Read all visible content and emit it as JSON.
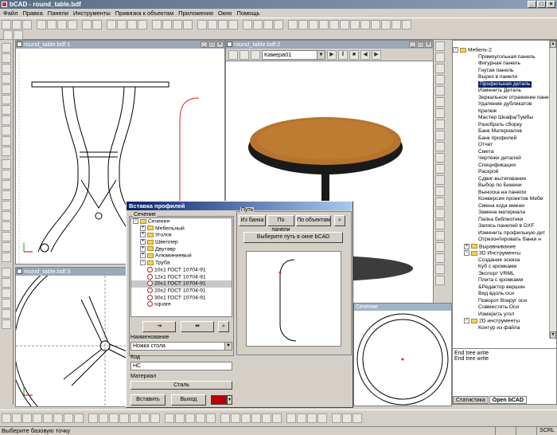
{
  "app": {
    "title": "bCAD - round_table.bdf",
    "win_buttons": [
      "_",
      "□",
      "×"
    ]
  },
  "menu": [
    "Файл",
    "Правка",
    "Панели",
    "Инструменты",
    "Привязка к объектам",
    "Приложения",
    "Окно",
    "Помощь"
  ],
  "windows": {
    "view1_title": "round_table.bdf:1",
    "view2_title": "round_table.bdf:2",
    "view3_title": "round_table.bdf:3",
    "camera": "Камера01",
    "section_title": "Сечение"
  },
  "tree": {
    "root": "Мебель-2",
    "items": [
      "Прямоугольная панель",
      "Фигурная панель",
      "Гнутая панель",
      "Вырез в панели",
      "Профильная деталь",
      "Изменить Деталь",
      "Зеркальное отражение пане",
      "Удаление дубликатов",
      "Крепеж",
      "Мастер Шкафа/Тумбы",
      "Разобрать сборку",
      "Банк Материалов",
      "Банк профилей",
      "Отчет",
      "Смета",
      "Чертежи деталей",
      "Спецификация",
      "Раскрой",
      "Сдвиг-вытягивание",
      "Выбор по Бинени",
      "Выноска на панели",
      "Конверсия проектов Мебе",
      "Смена кода имени",
      "Замена материала",
      "Папка библиотеки",
      "Запись панелей в DXF",
      "Изменить профильную дет",
      "Отрезонтировать банки н"
    ],
    "selected": "Профильная деталь",
    "group2": "Выравнивание",
    "group3": "3D Инструменты",
    "items3": [
      "Создание эскиза",
      "Куб с кромками",
      "Экспорт VRML",
      "Плита с кромками",
      "&Редактор вершин",
      "Вид вдоль оси",
      "Поворот Вокруг оси",
      "Совместить Оси",
      "Измерить угол"
    ],
    "group4": "2D инструменты",
    "last": "Контур из файла"
  },
  "log": [
    "End tree write",
    "End tree write"
  ],
  "right_tabs": [
    "Статистика",
    "Open bCAD"
  ],
  "status": {
    "text": "Выберите базовую точку",
    "cells": [
      "",
      "",
      "SCRL"
    ]
  },
  "dialog": {
    "title": "Вставка профилей",
    "section_group": "Сечение",
    "path_group": "Путь",
    "tree": [
      {
        "label": "Сечения",
        "level": 0,
        "kind": "folder",
        "pm": "−"
      },
      {
        "label": "Мебельный",
        "level": 1,
        "kind": "folder",
        "pm": "+"
      },
      {
        "label": "Уголок",
        "level": 1,
        "kind": "folder",
        "pm": "+"
      },
      {
        "label": "Швеллер",
        "level": 1,
        "kind": "folder",
        "pm": "+"
      },
      {
        "label": "Двутавр",
        "level": 1,
        "kind": "folder",
        "pm": "+"
      },
      {
        "label": "Алюминиевый",
        "level": 1,
        "kind": "folder",
        "pm": "+"
      },
      {
        "label": "Труба",
        "level": 1,
        "kind": "folder",
        "pm": "−"
      },
      {
        "label": "10x1 ГОСТ 10704-91",
        "level": 2,
        "kind": "profile"
      },
      {
        "label": "12x1 ГОСТ 10704-91",
        "level": 2,
        "kind": "profile"
      },
      {
        "label": "20x1 ГОСТ 10704-91",
        "level": 2,
        "kind": "profile",
        "selected": true
      },
      {
        "label": "20x2 ГОСТ 10704-91",
        "level": 2,
        "kind": "profile"
      },
      {
        "label": "30x1 ГОСТ 10704-91",
        "level": 2,
        "kind": "profile"
      },
      {
        "label": "square",
        "level": 2,
        "kind": "profile"
      }
    ],
    "path_buttons": [
      "Из банка",
      "По панели",
      "По объектам"
    ],
    "pick_path": "Выберите путь в окне bCAD",
    "name_label": "Наименование",
    "name_value": "Ножка стола",
    "code_label": "Код",
    "code_value": "НС",
    "material_label": "Материал",
    "material_value": "Сталь",
    "insert_btn": "Вставить",
    "exit_btn": "Выход",
    "color": "#c00000",
    "color_arrow": "▾"
  },
  "colors": {
    "tabletop": "#b7742c",
    "edge": "#1a1a1a",
    "path_red": "#dd2222"
  }
}
